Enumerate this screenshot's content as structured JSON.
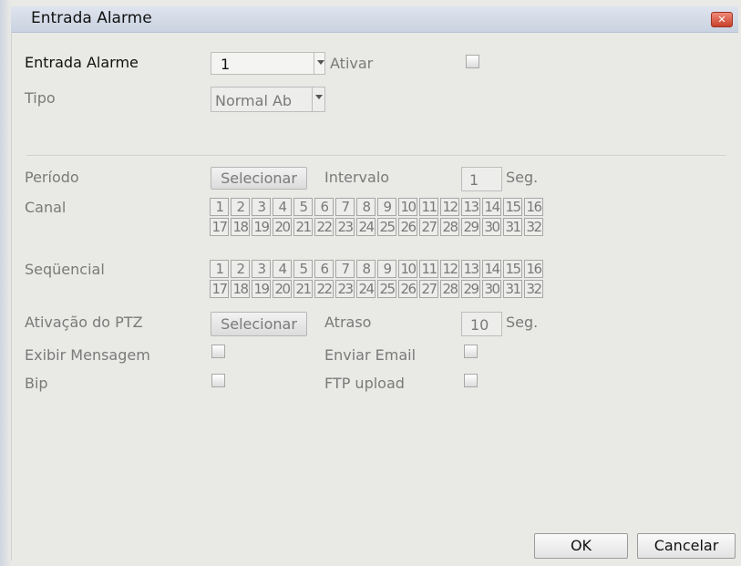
{
  "window": {
    "title": "Entrada Alarme"
  },
  "form": {
    "entrada_label": "Entrada Alarme",
    "entrada_value": "1",
    "ativar_label": "Ativar",
    "tipo_label": "Tipo",
    "tipo_value": "Normal Ab",
    "periodo_label": "Período",
    "periodo_button": "Selecionar",
    "intervalo_label": "Intervalo",
    "intervalo_value": "1",
    "intervalo_unit": "Seg.",
    "canal_label": "Canal",
    "sequencial_label": "Seqüencial",
    "ptz_label": "Ativação do PTZ",
    "ptz_button": "Selecionar",
    "atraso_label": "Atraso",
    "atraso_value": "10",
    "atraso_unit": "Seg.",
    "exibir_label": "Exibir Mensagem",
    "email_label": "Enviar Email",
    "bip_label": "Bip",
    "ftp_label": "FTP upload"
  },
  "channels": [
    "1",
    "2",
    "3",
    "4",
    "5",
    "6",
    "7",
    "8",
    "9",
    "10",
    "11",
    "12",
    "13",
    "14",
    "15",
    "16",
    "17",
    "18",
    "19",
    "20",
    "21",
    "22",
    "23",
    "24",
    "25",
    "26",
    "27",
    "28",
    "29",
    "30",
    "31",
    "32"
  ],
  "footer": {
    "ok": "OK",
    "cancel": "Cancelar"
  }
}
